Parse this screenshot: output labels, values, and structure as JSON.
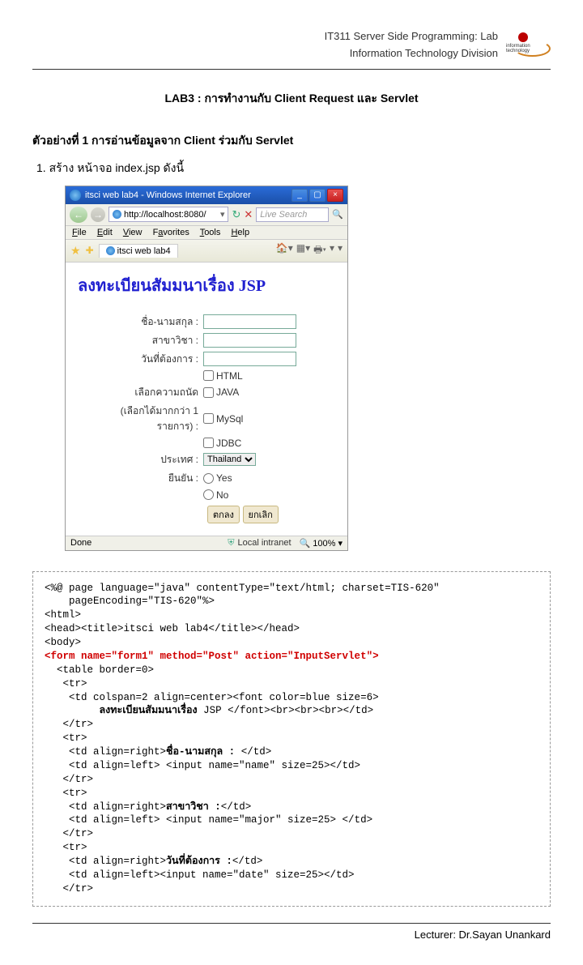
{
  "header": {
    "course": "IT311 Server Side Programming: Lab",
    "division": "Information Technology Division",
    "logo_label": "information technology"
  },
  "title": "LAB3 : การทำงานกับ Client Request และ Servlet",
  "example_heading": "ตัวอย่างที่ 1 การอ่านข้อมูลจาก Client ร่วมกับ Servlet",
  "step1": "1.   สร้าง หน้าจอ index.jsp ดังนี้",
  "screenshot": {
    "window_title": "itsci web lab4 - Windows Internet Explorer",
    "url": "http://localhost:8080/",
    "search_placeholder": "Live Search",
    "menus": {
      "file": "File",
      "edit": "Edit",
      "view": "View",
      "favorites": "Favorites",
      "tools": "Tools",
      "help": "Help"
    },
    "tab_label": "itsci web lab4",
    "page_heading": "ลงทะเบียนสัมมนาเรื่อง JSP",
    "labels": {
      "name": "ชื่อ-นามสกุล :",
      "major": "สาขาวิชา :",
      "date": "วันที่ต้องการ :",
      "skill": "เลือกความถนัด",
      "skill_note": "(เลือกได้มากกว่า 1 รายการ)  :",
      "country": "ประเทศ :",
      "confirm": "ยืนยัน :"
    },
    "checkboxes": [
      "HTML",
      "JAVA",
      "MySql",
      "JDBC"
    ],
    "country_option": "Thailand",
    "radios": [
      "Yes",
      "No"
    ],
    "buttons": {
      "submit": "ตกลง",
      "cancel": "ยกเลิก"
    },
    "status": {
      "done": "Done",
      "zone": "Local intranet",
      "zoom": "100%"
    }
  },
  "code": {
    "l1": "<%@ page language=\"java\" contentType=\"text/html; charset=TIS-620\"",
    "l2": "    pageEncoding=\"TIS-620\"%>",
    "l3": "<html>",
    "l4": "<head><title>itsci web lab4</title></head>",
    "l5": "<body>",
    "l6": "<form name=\"form1\" method=\"Post\" action=\"InputServlet\">",
    "l7": "  <table border=0>",
    "l8": "   <tr>",
    "l9": "    <td colspan=2 align=center><font color=blue size=6>",
    "l10a": "         ",
    "l10b": "ลงทะเบียนสัมมนาเรื่อง",
    "l10c": " JSP </font><br><br><br></td>",
    "l11": "   </tr>",
    "l12": "   <tr>",
    "l13a": "    <td align=right>",
    "l13b": "ชื่อ-นามสกุล :",
    "l13c": " </td>",
    "l14": "    <td align=left> <input name=\"name\" size=25></td>",
    "l15": "   </tr>",
    "l16": "   <tr>",
    "l17a": "    <td align=right>",
    "l17b": "สาขาวิชา :",
    "l17c": "</td>",
    "l18": "    <td align=left> <input name=\"major\" size=25> </td>",
    "l19": "   </tr>",
    "l20": "   <tr>",
    "l21a": "    <td align=right>",
    "l21b": "วันที่ต้องการ :",
    "l21c": "</td>",
    "l22": "    <td align=left><input name=\"date\" size=25></td>",
    "l23": "   </tr>"
  },
  "footer": "Lecturer:  Dr.Sayan Unankard"
}
